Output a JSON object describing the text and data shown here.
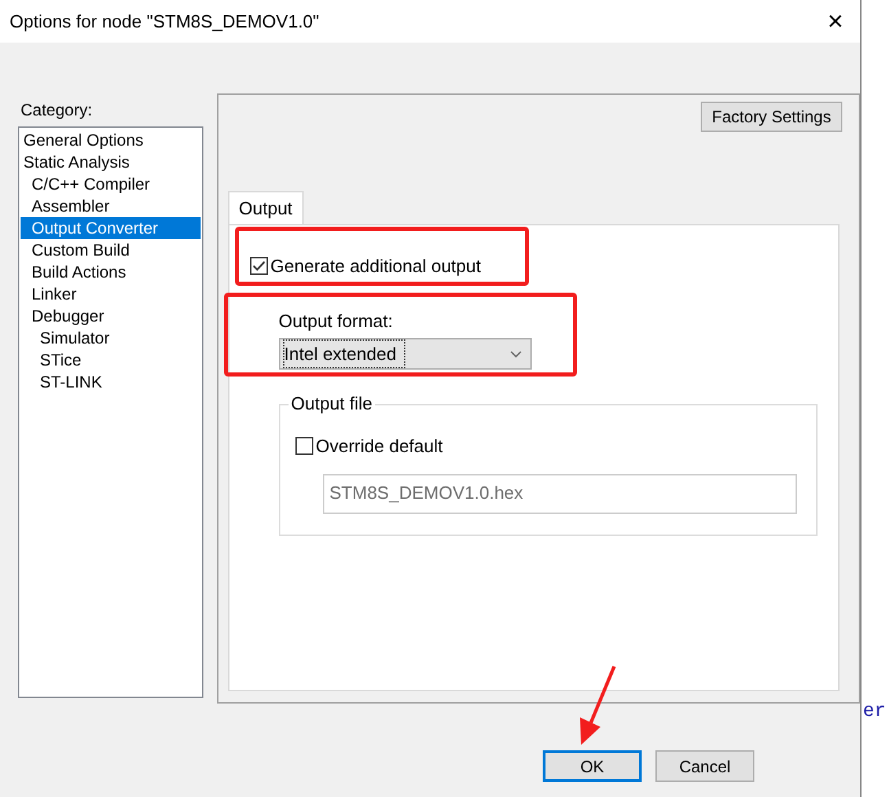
{
  "window": {
    "title": "Options for node \"STM8S_DEMOV1.0\"",
    "close": "×"
  },
  "category": {
    "label": "Category:",
    "items": [
      {
        "label": "General Options",
        "selected": false
      },
      {
        "label": "Static Analysis",
        "selected": false,
        "children": [
          {
            "label": "C/C++ Compiler",
            "selected": false
          },
          {
            "label": "Assembler",
            "selected": false
          },
          {
            "label": "Output Converter",
            "selected": true
          },
          {
            "label": "Custom Build",
            "selected": false
          },
          {
            "label": "Build Actions",
            "selected": false
          },
          {
            "label": "Linker",
            "selected": false
          },
          {
            "label": "Debugger",
            "selected": false,
            "children": [
              {
                "label": "Simulator",
                "selected": false
              },
              {
                "label": "STice",
                "selected": false
              },
              {
                "label": "ST-LINK",
                "selected": false
              }
            ]
          }
        ]
      }
    ]
  },
  "factory_button": "Factory Settings",
  "tabs": [
    {
      "label": "Output",
      "selected": true
    }
  ],
  "generate_output": {
    "label": "Generate additional output",
    "checked": true
  },
  "output_format": {
    "label": "Output format:",
    "value": "Intel extended"
  },
  "output_file": {
    "legend": "Output file",
    "override": {
      "label": "Override default",
      "checked": false
    },
    "value": "STM8S_DEMOV1.0.hex"
  },
  "buttons": [
    {
      "label": "OK",
      "default": true
    },
    {
      "label": "Cancel",
      "default": false
    }
  ],
  "background_text": "er"
}
